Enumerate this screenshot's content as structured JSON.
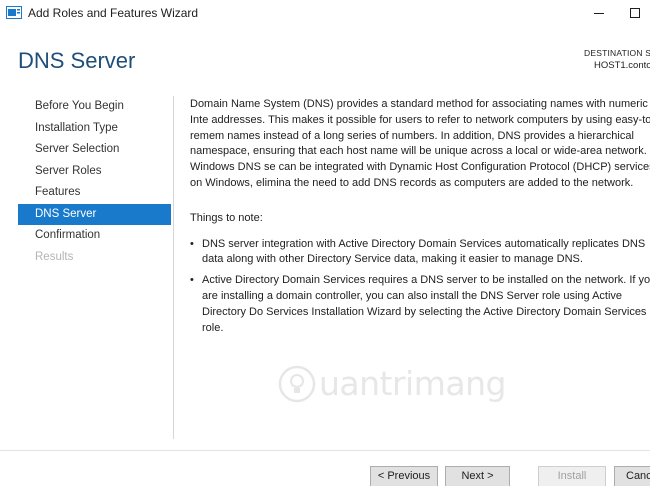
{
  "window": {
    "title": "Add Roles and Features Wizard",
    "icon": "server-manager-icon"
  },
  "header": {
    "title": "DNS Server",
    "destination_label": "DESTINATION SE",
    "destination_server": "HOST1.contosc"
  },
  "nav": {
    "items": [
      {
        "label": "Before You Begin",
        "state": "normal"
      },
      {
        "label": "Installation Type",
        "state": "normal"
      },
      {
        "label": "Server Selection",
        "state": "normal"
      },
      {
        "label": "Server Roles",
        "state": "normal"
      },
      {
        "label": "Features",
        "state": "normal"
      },
      {
        "label": "DNS Server",
        "state": "selected"
      },
      {
        "label": "Confirmation",
        "state": "normal"
      },
      {
        "label": "Results",
        "state": "disabled"
      }
    ]
  },
  "content": {
    "intro": "Domain Name System (DNS) provides a standard method for associating names with numeric Inte addresses. This makes it possible for users to refer to network computers by using easy-to-remem names instead of a long series of numbers. In addition, DNS provides a hierarchical namespace, ensuring that each host name will be unique across a local or wide-area network. Windows DNS se can be integrated with Dynamic Host Configuration Protocol (DHCP) services on Windows, elimina the need to add DNS records as computers are added to the network.",
    "things_heading": "Things to note:",
    "bullets": [
      "DNS server integration with Active Directory Domain Services automatically replicates DNS data along with other Directory Service data, making it easier to manage DNS.",
      "Active Directory Domain Services requires a DNS server to be installed on the network. If you are installing a domain controller, you can also install the DNS Server role using Active Directory Do Services Installation Wizard by selecting the Active Directory Domain Services role."
    ]
  },
  "watermark": {
    "text": "uantrimang"
  },
  "footer": {
    "previous_label": "< Previous",
    "next_label": "Next >",
    "install_label": "Install",
    "cancel_label": "Canc"
  },
  "colors": {
    "accent": "#1979ca",
    "title": "#1f4e79",
    "disabled_text": "#b4b4b4"
  }
}
